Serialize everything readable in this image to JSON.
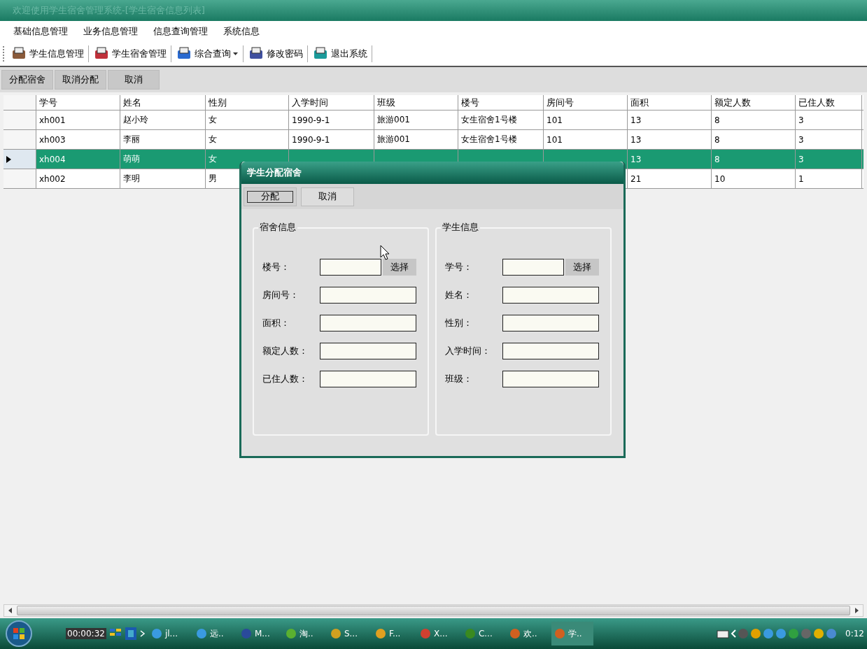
{
  "window": {
    "title": "欢迎使用学生宿舍管理系统-[学生宿舍信息列表]"
  },
  "menu": [
    "基础信息管理",
    "业务信息管理",
    "信息查询管理",
    "系统信息"
  ],
  "toolbar": [
    {
      "label": "学生信息管理",
      "kind": "button"
    },
    {
      "label": "学生宿舍管理",
      "kind": "button"
    },
    {
      "label": "综合查询",
      "kind": "dropdown"
    },
    {
      "label": "修改密码",
      "kind": "button"
    },
    {
      "label": "退出系统",
      "kind": "button"
    }
  ],
  "actions": [
    "分配宿舍",
    "取消分配",
    "取消"
  ],
  "table": {
    "columns": [
      "学号",
      "姓名",
      "性别",
      "入学时间",
      "班级",
      "楼号",
      "房间号",
      "面积",
      "额定人数",
      "已住人数"
    ],
    "rows": [
      {
        "selected": false,
        "cells": [
          "xh001",
          "赵小玲",
          "女",
          "1990-9-1",
          "旅游001",
          "女生宿舍1号楼",
          "101",
          "13",
          "8",
          "3"
        ]
      },
      {
        "selected": false,
        "cells": [
          "xh003",
          "李丽",
          "女",
          "1990-9-1",
          "旅游001",
          "女生宿舍1号楼",
          "101",
          "13",
          "8",
          "3"
        ]
      },
      {
        "selected": true,
        "cells": [
          "xh004",
          "萌萌",
          "女",
          null,
          null,
          null,
          null,
          "13",
          "8",
          "3"
        ]
      },
      {
        "selected": false,
        "cells": [
          "xh002",
          "李明",
          "男",
          null,
          null,
          null,
          null,
          "21",
          "10",
          "1"
        ]
      }
    ]
  },
  "dialog": {
    "title": "学生分配宿舍",
    "buttons": [
      "分配",
      "取消"
    ],
    "groups": [
      {
        "title": "宿舍信息",
        "fields": [
          {
            "label": "楼号：",
            "kind": "picker",
            "button": "选择"
          },
          {
            "label": "房间号：",
            "kind": "text"
          },
          {
            "label": "面积：",
            "kind": "text"
          },
          {
            "label": "额定人数：",
            "kind": "text"
          },
          {
            "label": "已住人数：",
            "kind": "text"
          }
        ]
      },
      {
        "title": "学生信息",
        "fields": [
          {
            "label": "学号：",
            "kind": "picker",
            "button": "选择"
          },
          {
            "label": "姓名：",
            "kind": "text"
          },
          {
            "label": "性别：",
            "kind": "text"
          },
          {
            "label": "入学时间：",
            "kind": "text"
          },
          {
            "label": "班级：",
            "kind": "text"
          }
        ]
      }
    ]
  },
  "taskbar": {
    "timer": "00:00:32",
    "tasks": [
      {
        "label": "jl...",
        "selected": false
      },
      {
        "label": "远..",
        "selected": false
      },
      {
        "label": "M...",
        "selected": false
      },
      {
        "label": "淘..",
        "selected": false
      },
      {
        "label": "S...",
        "selected": false
      },
      {
        "label": "F...",
        "selected": false
      },
      {
        "label": "X...",
        "selected": false
      },
      {
        "label": "C...",
        "selected": false
      },
      {
        "label": "欢..",
        "selected": false
      },
      {
        "label": "学..",
        "selected": true
      }
    ],
    "clock": "0:12"
  }
}
